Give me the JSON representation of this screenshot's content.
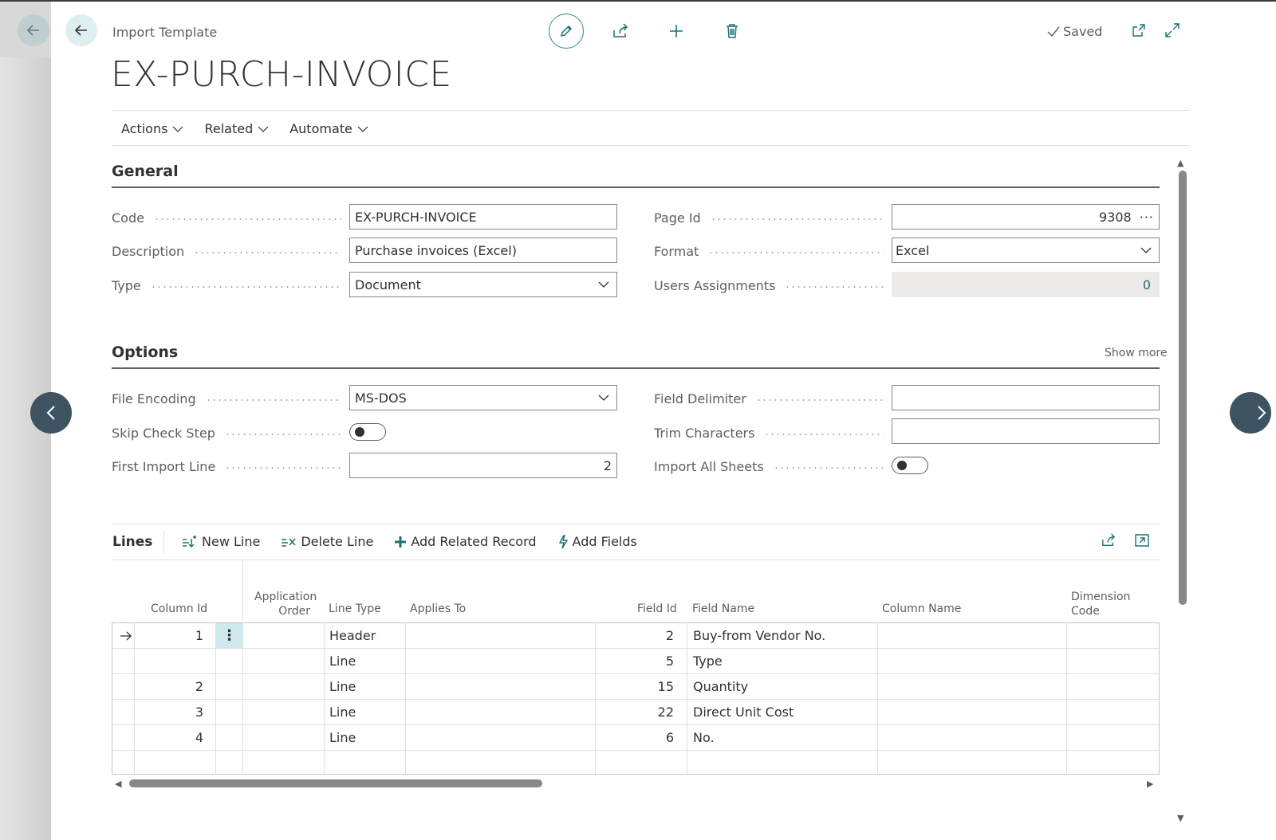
{
  "header": {
    "breadcrumb": "Import Template",
    "title": "EX-PURCH-INVOICE",
    "saved_label": "Saved"
  },
  "menu": {
    "items": [
      "Actions",
      "Related",
      "Automate"
    ]
  },
  "general": {
    "title": "General",
    "code_label": "Code",
    "code_value": "EX-PURCH-INVOICE",
    "description_label": "Description",
    "description_value": "Purchase invoices (Excel)",
    "type_label": "Type",
    "type_value": "Document",
    "page_id_label": "Page Id",
    "page_id_value": "9308",
    "page_id_ellipsis": "···",
    "format_label": "Format",
    "format_value": "Excel",
    "users_assignments_label": "Users Assignments",
    "users_assignments_value": "0"
  },
  "options": {
    "title": "Options",
    "show_more": "Show more",
    "file_encoding_label": "File Encoding",
    "file_encoding_value": "MS-DOS",
    "skip_check_step_label": "Skip Check Step",
    "skip_check_step_on": false,
    "first_import_line_label": "First Import Line",
    "first_import_line_value": "2",
    "field_delimiter_label": "Field Delimiter",
    "field_delimiter_value": "",
    "trim_characters_label": "Trim Characters",
    "trim_characters_value": "",
    "import_all_sheets_label": "Import All Sheets",
    "import_all_sheets_on": false
  },
  "lines": {
    "title": "Lines",
    "actions": {
      "new_line": "New Line",
      "delete_line": "Delete Line",
      "add_related_record": "Add Related Record",
      "add_fields": "Add Fields"
    },
    "columns": {
      "column_id": "Column Id",
      "application_order_1": "Application",
      "application_order_2": "Order",
      "line_type": "Line Type",
      "applies_to": "Applies To",
      "field_id": "Field Id",
      "field_name": "Field Name",
      "column_name": "Column Name",
      "dimension_code_1": "Dimension",
      "dimension_code_2": "Code"
    },
    "rows": [
      {
        "column_id": "1",
        "line_type": "Header",
        "field_id": "2",
        "field_name": "Buy-from Vendor No."
      },
      {
        "column_id": "",
        "line_type": "Line",
        "field_id": "5",
        "field_name": "Type"
      },
      {
        "column_id": "2",
        "line_type": "Line",
        "field_id": "15",
        "field_name": "Quantity"
      },
      {
        "column_id": "3",
        "line_type": "Line",
        "field_id": "22",
        "field_name": "Direct Unit Cost"
      },
      {
        "column_id": "4",
        "line_type": "Line",
        "field_id": "6",
        "field_name": "No."
      },
      {
        "column_id": "",
        "line_type": "",
        "field_id": "",
        "field_name": ""
      }
    ]
  },
  "colors": {
    "accent": "#1f6f73",
    "nav_button": "#3d5361",
    "selected_cell": "#cfe9ec"
  }
}
